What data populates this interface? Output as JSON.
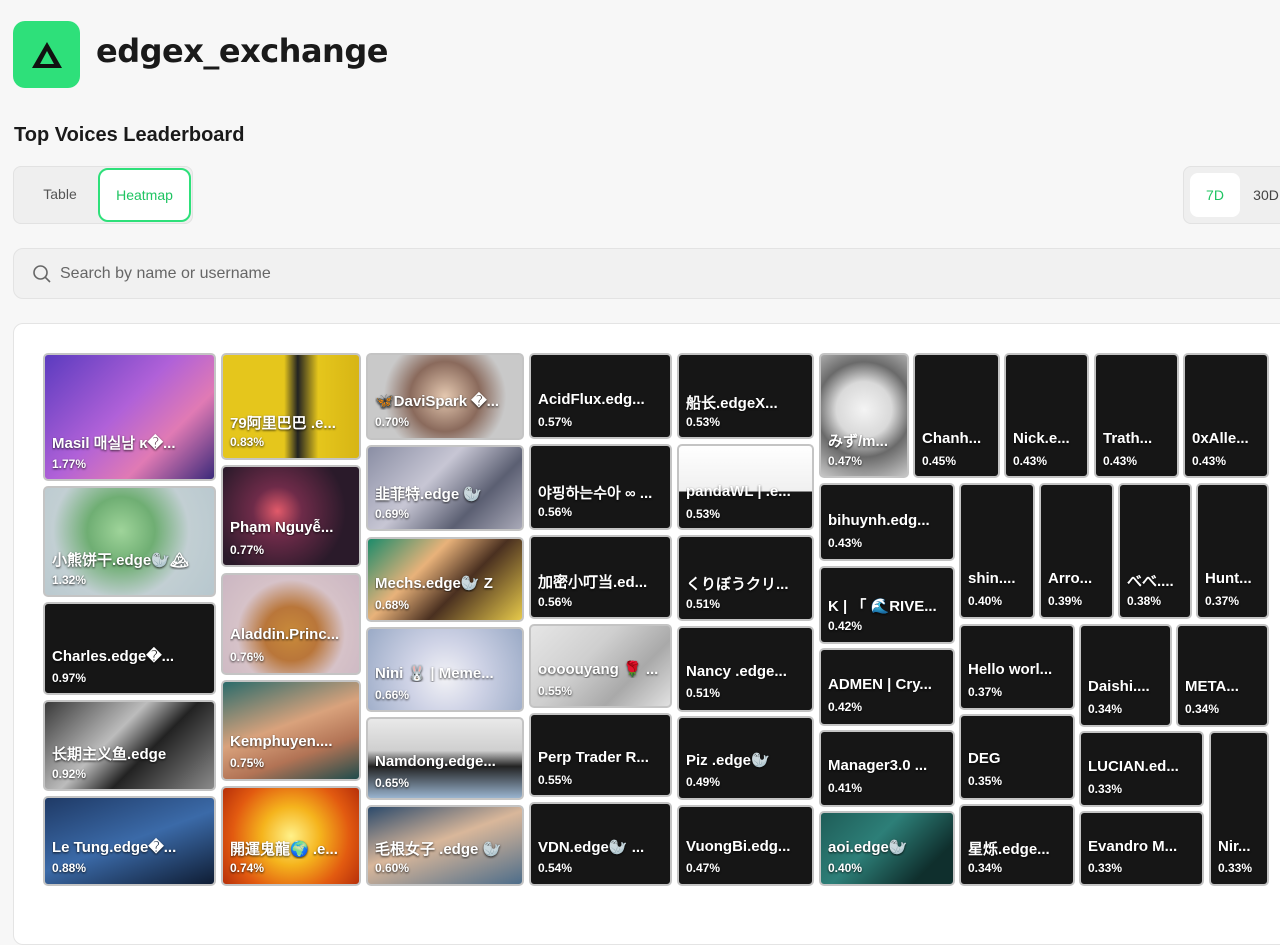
{
  "app": {
    "title": "edgex_exchange",
    "logo": "triangle-logo-icon",
    "brand_color": "#2ee07a"
  },
  "section_title": "Top Voices Leaderboard",
  "view_tabs": [
    {
      "label": "Table",
      "active": false
    },
    {
      "label": "Heatmap",
      "active": true
    }
  ],
  "period_tabs": [
    {
      "label": "7D",
      "active": true
    },
    {
      "label": "30D",
      "active": false
    }
  ],
  "search": {
    "placeholder": "Search by name or username",
    "value": ""
  },
  "heatmap": {
    "tiles": [
      {
        "name": "Masil 매실남 κ�...",
        "pct": "1.77%"
      },
      {
        "name": "小熊饼干.edge🦭🏔",
        "pct": "1.32%"
      },
      {
        "name": "Charles.edge�...",
        "pct": "0.97%"
      },
      {
        "name": "长期主义鱼.edge",
        "pct": "0.92%"
      },
      {
        "name": "Le Tung.edge�...",
        "pct": "0.88%"
      },
      {
        "name": "79阿里巴巴 .e...",
        "pct": "0.83%"
      },
      {
        "name": "Phạm Nguyễ...",
        "pct": "0.77%"
      },
      {
        "name": "Aladdin.Princ...",
        "pct": "0.76%"
      },
      {
        "name": "Kemphuyen....",
        "pct": "0.75%"
      },
      {
        "name": "開運鬼龍🌍 .e...",
        "pct": "0.74%"
      },
      {
        "name": "🦋DaviSpark �...",
        "pct": "0.70%"
      },
      {
        "name": "韭菲特.edge 🦭",
        "pct": "0.69%"
      },
      {
        "name": "Mechs.edge🦭 Z",
        "pct": "0.68%"
      },
      {
        "name": "Nini 🐰 | Meme...",
        "pct": "0.66%"
      },
      {
        "name": "Namdong.edge...",
        "pct": "0.65%"
      },
      {
        "name": "毛根女子 .edge 🦭",
        "pct": "0.60%"
      },
      {
        "name": "AcidFlux.edg...",
        "pct": "0.57%"
      },
      {
        "name": "야핑하는수아 ∞ ...",
        "pct": "0.56%"
      },
      {
        "name": "加密小叮当.ed...",
        "pct": "0.56%"
      },
      {
        "name": "oooouyang 🌹 ...",
        "pct": "0.55%"
      },
      {
        "name": "Perp Trader R...",
        "pct": "0.55%"
      },
      {
        "name": "VDN.edge🦭 ...",
        "pct": "0.54%"
      },
      {
        "name": "船长.edgeX...",
        "pct": "0.53%"
      },
      {
        "name": "pandaWL | .e...",
        "pct": "0.53%"
      },
      {
        "name": "くりぼうクリ...",
        "pct": "0.51%"
      },
      {
        "name": "Nancy .edge...",
        "pct": "0.51%"
      },
      {
        "name": "Piz .edge🦭",
        "pct": "0.49%"
      },
      {
        "name": "VuongBi.edg...",
        "pct": "0.47%"
      },
      {
        "name": "みず/m...",
        "pct": "0.47%"
      },
      {
        "name": "Chanh...",
        "pct": "0.45%"
      },
      {
        "name": "Nick.e...",
        "pct": "0.43%"
      },
      {
        "name": "Trath...",
        "pct": "0.43%"
      },
      {
        "name": "0xAlle...",
        "pct": "0.43%"
      },
      {
        "name": "bihuynh.edg...",
        "pct": "0.43%"
      },
      {
        "name": "K | 「 🌊RIVE...",
        "pct": "0.42%"
      },
      {
        "name": "ADMEN | Cry...",
        "pct": "0.42%"
      },
      {
        "name": "Manager3.0 ...",
        "pct": "0.41%"
      },
      {
        "name": "aoi.edge🦭",
        "pct": "0.40%"
      },
      {
        "name": "shin....",
        "pct": "0.40%"
      },
      {
        "name": "Arro...",
        "pct": "0.39%"
      },
      {
        "name": "べべ....",
        "pct": "0.38%"
      },
      {
        "name": "Hunt...",
        "pct": "0.37%"
      },
      {
        "name": "Hello worl...",
        "pct": "0.37%"
      },
      {
        "name": "Daishi....",
        "pct": "0.34%"
      },
      {
        "name": "META...",
        "pct": "0.34%"
      },
      {
        "name": "DEG",
        "pct": "0.35%"
      },
      {
        "name": "LUCIAN.ed...",
        "pct": "0.33%"
      },
      {
        "name": "星烁.edge...",
        "pct": "0.34%"
      },
      {
        "name": "Evandro M...",
        "pct": "0.33%"
      },
      {
        "name": "Nir...",
        "pct": "0.33%"
      }
    ]
  }
}
